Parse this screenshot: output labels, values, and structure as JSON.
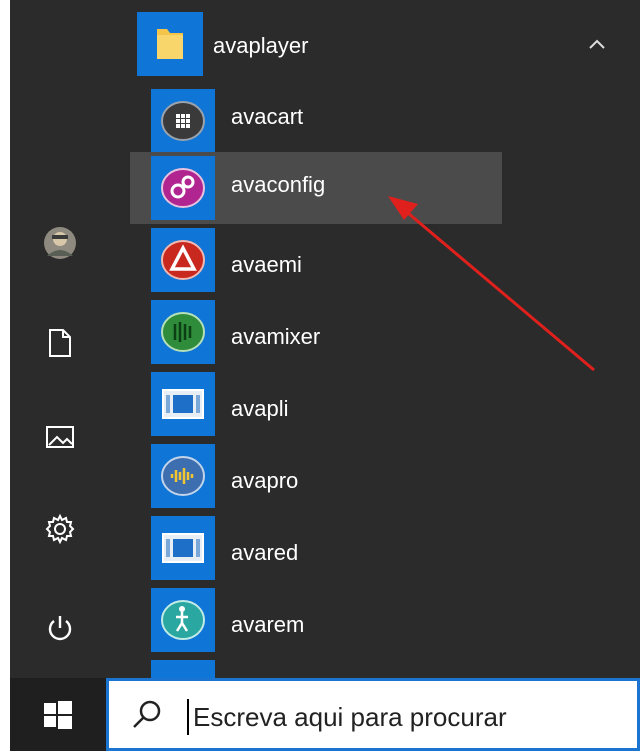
{
  "folder": {
    "label": "avaplayer"
  },
  "apps": [
    {
      "label": "avacart",
      "icon": "avacart-icon"
    },
    {
      "label": "avaconfig",
      "icon": "avaconfig-icon"
    },
    {
      "label": "avaemi",
      "icon": "avaemi-icon"
    },
    {
      "label": "avamixer",
      "icon": "avamixer-icon"
    },
    {
      "label": "avapli",
      "icon": "avapli-icon"
    },
    {
      "label": "avapro",
      "icon": "avapro-icon"
    },
    {
      "label": "avared",
      "icon": "avared-icon"
    },
    {
      "label": "avarem",
      "icon": "avarem-icon"
    }
  ],
  "search": {
    "placeholder": "Escreva aqui para procurar"
  },
  "colors": {
    "accent": "#0f75d6",
    "menu_bg": "#2b2b2b",
    "highlight": "#4b4b4b",
    "annotation_arrow": "#e0201c"
  }
}
